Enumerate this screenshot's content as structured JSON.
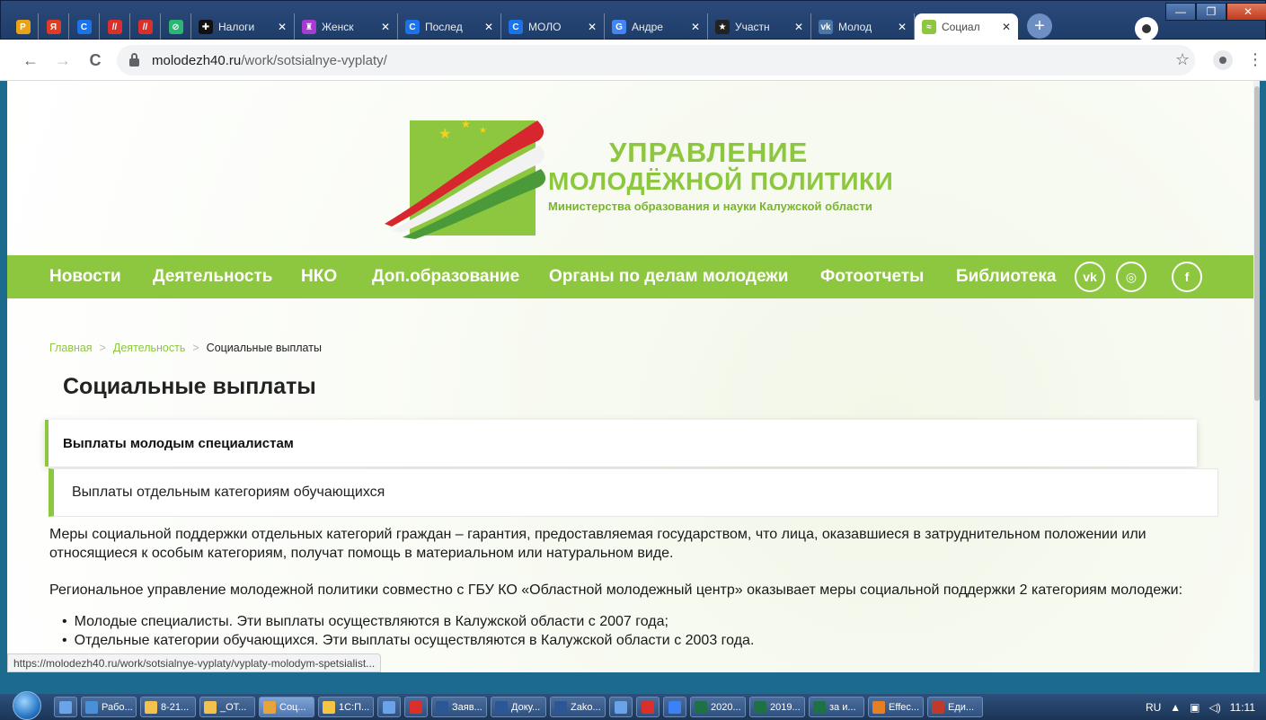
{
  "browser": {
    "tabs": [
      {
        "title": "",
        "favicon": "P",
        "color": "#e8a317",
        "pinned": true
      },
      {
        "title": "",
        "favicon": "Я",
        "color": "#e03b24",
        "pinned": true
      },
      {
        "title": "",
        "favicon": "C",
        "color": "#1a73e8",
        "pinned": true
      },
      {
        "title": "",
        "favicon": "//",
        "color": "#d9302c",
        "pinned": true
      },
      {
        "title": "",
        "favicon": "//",
        "color": "#d9302c",
        "pinned": true
      },
      {
        "title": "",
        "favicon": "⊘",
        "color": "#2bb673",
        "pinned": true
      },
      {
        "title": "Налоги",
        "favicon": "✚",
        "color": "#111111",
        "pinned": false
      },
      {
        "title": "Женск",
        "favicon": "♜",
        "color": "#a83bd1",
        "pinned": false
      },
      {
        "title": "Послед",
        "favicon": "C",
        "color": "#1a73e8",
        "pinned": false
      },
      {
        "title": "МОЛО",
        "favicon": "C",
        "color": "#1a73e8",
        "pinned": false
      },
      {
        "title": "Андре",
        "favicon": "G",
        "color": "#4285f4",
        "pinned": false
      },
      {
        "title": "Участн",
        "favicon": "★",
        "color": "#222222",
        "pinned": false
      },
      {
        "title": "Молод",
        "favicon": "vk",
        "color": "#4a76a8",
        "pinned": false
      },
      {
        "title": "Социал",
        "favicon": "≈",
        "color": "#8dc63f",
        "pinned": false,
        "active": true
      }
    ],
    "new_tab": "+",
    "close_glyph": "✕",
    "url_host": "molodezh40.ru",
    "url_path": "/work/sotsialnye-vyplaty/",
    "back": "←",
    "forward": "→",
    "reload": "C",
    "star": "☆",
    "menu": "⋮",
    "window_controls": {
      "minimize": "—",
      "maximize": "❐",
      "close": "✕"
    }
  },
  "logo": {
    "title": "УПРАВЛЕНИЕ",
    "subtitle": "МОЛОДЁЖНОЙ ПОЛИТИКИ",
    "line": "Министерства образования и науки Калужской области"
  },
  "nav": {
    "items": [
      "Новости",
      "Деятельность",
      "НКО",
      "Доп.образование",
      "Органы по делам молодежи",
      "Фотоотчеты",
      "Библиотека"
    ],
    "social": [
      "vk",
      "◎",
      "f"
    ]
  },
  "breadcrumb": {
    "home": "Главная",
    "section": "Деятельность",
    "current": "Социальные выплаты",
    "sep": ">"
  },
  "page_title": "Социальные выплаты",
  "accordion": {
    "open_label": "Выплаты молодым специалистам",
    "closed_label": "Выплаты отдельным категориям обучающихся"
  },
  "content": {
    "p1": "Меры социальной поддержки отдельных категорий граждан – гарантия, предоставляемая государством, что лица, оказавшиеся в затруднительном положении или относящиеся к особым категориям, получат помощь в материальном или натуральном виде.",
    "p2": "Региональное управление молодежной политики совместно с ГБУ КО «Областной молодежный центр» оказывает меры социальной поддержки 2 категориям молодежи:",
    "list": [
      "Молодые специалисты. Эти выплаты осуществляются в Калужской области с 2007 года;",
      "Отдельные категории обучающихся. Эти выплаты осуществляются в Калужской области с 2003 года."
    ]
  },
  "status_url": "https://molodezh40.ru/work/sotsialnye-vyplaty/vyplaty-molodym-spetsialist...",
  "taskbar": {
    "items": [
      {
        "label": "",
        "color": "#6aa3e8",
        "small": true
      },
      {
        "label": "Рабо...",
        "color": "#4a90d9"
      },
      {
        "label": "8-21...",
        "color": "#f2c14e"
      },
      {
        "label": "_ОТ...",
        "color": "#f2c14e"
      },
      {
        "label": "Соц...",
        "color": "#e9a33b",
        "active": true
      },
      {
        "label": "1С:П...",
        "color": "#f4c542"
      },
      {
        "label": "",
        "color": "#6aa3e8",
        "small": true
      },
      {
        "label": "",
        "color": "#d9302c",
        "small": true
      },
      {
        "label": "Заяв...",
        "color": "#2b5797"
      },
      {
        "label": "Доку...",
        "color": "#2b5797"
      },
      {
        "label": "Zako...",
        "color": "#2b5797"
      },
      {
        "label": "",
        "color": "#6aa3e8",
        "small": true
      },
      {
        "label": "",
        "color": "#d9302c",
        "small": true
      },
      {
        "label": "",
        "color": "#3b82f6",
        "small": true
      },
      {
        "label": "2020...",
        "color": "#1e7145"
      },
      {
        "label": "2019...",
        "color": "#1e7145"
      },
      {
        "label": "за и...",
        "color": "#1e7145"
      },
      {
        "label": "Effec...",
        "color": "#e67e22"
      },
      {
        "label": "Еди...",
        "color": "#c0392b"
      }
    ],
    "lang": "RU",
    "time": "11:11"
  }
}
